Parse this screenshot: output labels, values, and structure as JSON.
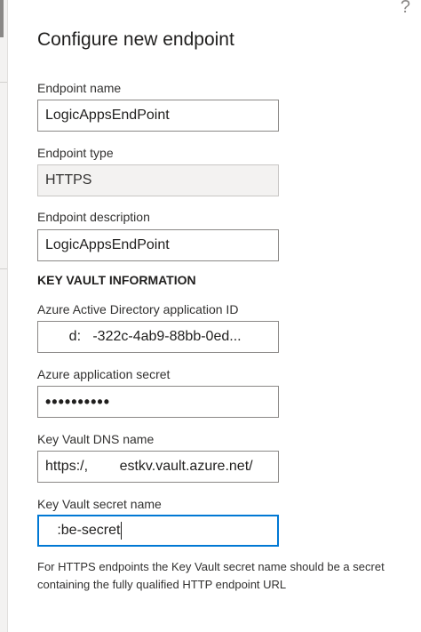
{
  "header": {
    "title": "Configure new endpoint",
    "help_icon": "question-icon"
  },
  "form": {
    "endpoint_name": {
      "label": "Endpoint name",
      "value": "LogicAppsEndPoint"
    },
    "endpoint_type": {
      "label": "Endpoint type",
      "value": "HTTPS"
    },
    "endpoint_description": {
      "label": "Endpoint description",
      "value": "LogicAppsEndPoint"
    }
  },
  "key_vault": {
    "heading": "KEY VAULT INFORMATION",
    "aad_app_id": {
      "label": "Azure Active Directory application ID",
      "value": "      d:   -322c-4ab9-88bb-0ed..."
    },
    "app_secret": {
      "label": "Azure application secret",
      "value": "••••••••••"
    },
    "dns_name": {
      "label": "Key Vault DNS name",
      "value": "https:/,        estkv.vault.azure.net/"
    },
    "secret_name": {
      "label": "Key Vault secret name",
      "value": "   :be-secret"
    },
    "hint": "For HTTPS endpoints the Key Vault secret name should be a secret containing the fully qualified HTTP endpoint URL"
  },
  "colors": {
    "focus": "#0078d4",
    "border": "#8a8886",
    "disabled_bg": "#f3f2f1",
    "text": "#323130"
  }
}
